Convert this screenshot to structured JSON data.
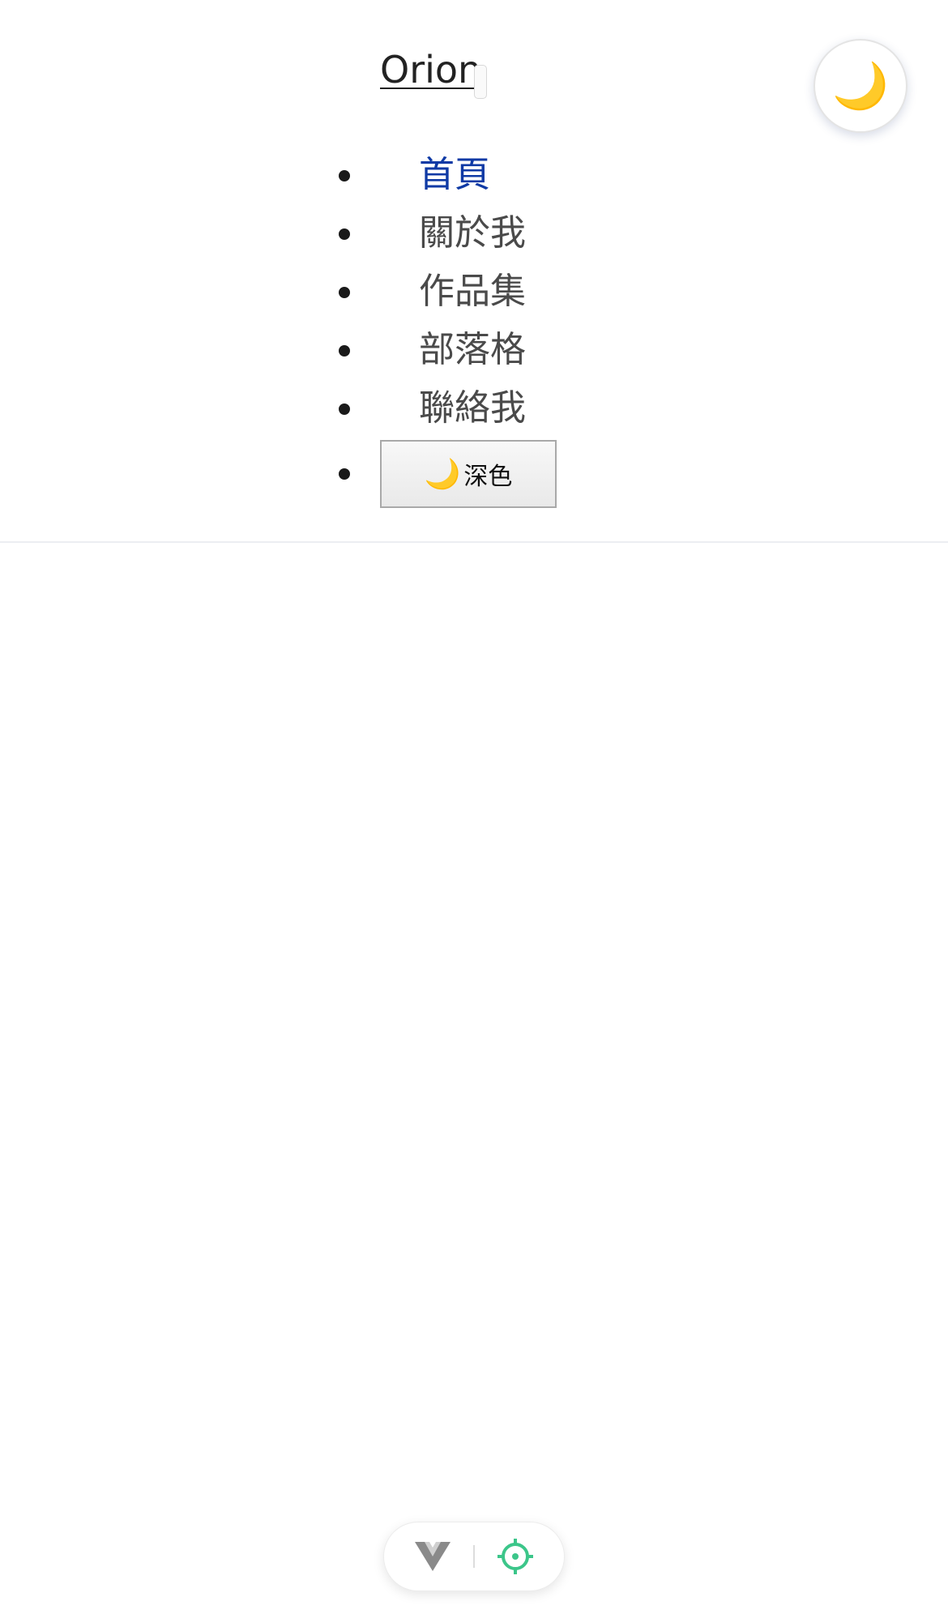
{
  "header": {
    "brand": "Orion",
    "theme_fab_icon": "moon-icon"
  },
  "nav": {
    "items": [
      {
        "label": "首頁",
        "active": true
      },
      {
        "label": "關於我",
        "active": false
      },
      {
        "label": "作品集",
        "active": false
      },
      {
        "label": "部落格",
        "active": false
      },
      {
        "label": "聯絡我",
        "active": false
      }
    ],
    "theme_button": {
      "icon": "moon-icon",
      "label": "深色"
    }
  },
  "devbar": {
    "icons": [
      "vue-devtools-icon",
      "inspector-target-icon"
    ]
  },
  "colors": {
    "active_link": "#0f3aa5",
    "link": "#4a4a4a",
    "inspector": "#3cc68a"
  }
}
